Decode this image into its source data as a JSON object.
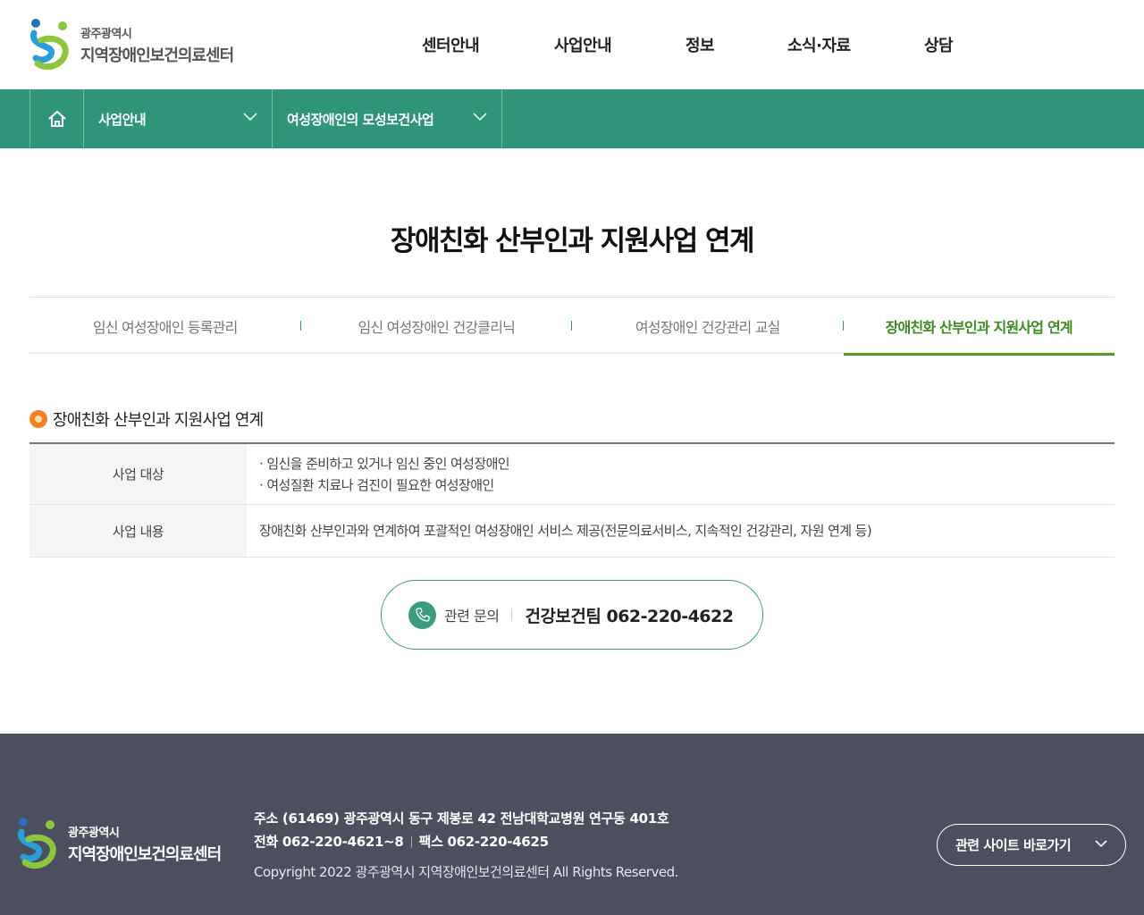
{
  "header": {
    "logo_sub": "광주광역시",
    "logo_main": "지역장애인보건의료센터",
    "nav": [
      "센터안내",
      "사업안내",
      "정보",
      "소식·자료",
      "상담"
    ]
  },
  "breadcrumb": {
    "level1": "사업안내",
    "level2": "여성장애인의 모성보건사업"
  },
  "page_title": "장애친화 산부인과 지원사업 연계",
  "tabs": [
    {
      "label": "임신 여성장애인 등록관리",
      "active": false
    },
    {
      "label": "임신 여성장애인 건강클리닉",
      "active": false
    },
    {
      "label": "여성장애인 건강관리 교실",
      "active": false
    },
    {
      "label": "장애친화 산부인과 지원사업 연계",
      "active": true
    }
  ],
  "section": {
    "title": "장애친화 산부인과 지원사업 연계",
    "rows": [
      {
        "label": "사업 대상",
        "lines": [
          "· 임신을 준비하고 있거나 임신 중인 여성장애인",
          "· 여성질환 치료나 검진이 필요한 여성장애인"
        ]
      },
      {
        "label": "사업 내용",
        "lines": [
          "장애친화 산부인과와 연계하여 포괄적인 여성장애인 서비스 제공(전문의료서비스, 지속적인 건강관리, 자원 연계 등)"
        ]
      }
    ]
  },
  "contact": {
    "label": "관련 문의",
    "value": "건강보건팀 062-220-4622"
  },
  "footer": {
    "logo_sub": "광주광역시",
    "logo_main": "지역장애인보건의료센터",
    "address": "주소 (61469) 광주광역시 동구 제봉로 42 전남대학교병원 연구동 401호",
    "phone": "전화 062-220-4621~8",
    "fax": "팩스 062-220-4625",
    "copyright": "Copyright 2022 광주광역시 지역장애인보건의료센터 All Rights Reserved.",
    "related_sites": "관련 사이트 바로가기"
  },
  "colors": {
    "brand_green": "#2f9479",
    "tab_active": "#3c8b1e",
    "bullet_orange": "#f58220",
    "footer_bg": "#4b4f5e"
  }
}
